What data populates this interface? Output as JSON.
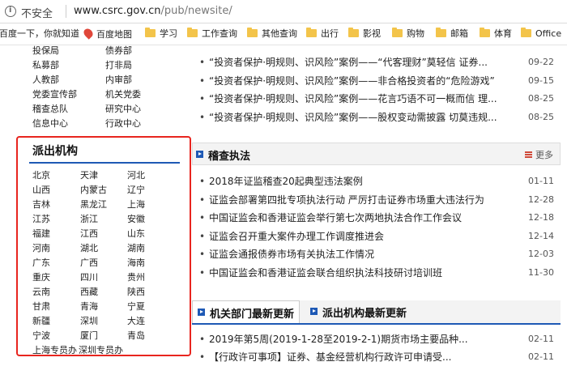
{
  "address_bar": {
    "security_label": "不安全",
    "url_host": "www.csrc.gov.cn",
    "url_path": "/pub/newsite/"
  },
  "bookmarks": [
    "百度一下，你就知道",
    "百度地图",
    "学习",
    "工作查询",
    "其他查询",
    "出行",
    "影视",
    "购物",
    "邮箱",
    "体育",
    "Office"
  ],
  "left_menu": [
    [
      "投保局",
      "债券部"
    ],
    [
      "私募部",
      "打非局"
    ],
    [
      "人教部",
      "内审部"
    ],
    [
      "党委宣传部",
      "机关党委"
    ],
    [
      "稽查总队",
      "研究中心"
    ],
    [
      "信息中心",
      "行政中心"
    ]
  ],
  "agencies": {
    "title": "派出机构",
    "rows": [
      [
        "北京",
        "天津",
        "河北"
      ],
      [
        "山西",
        "内蒙古",
        "辽宁"
      ],
      [
        "吉林",
        "黑龙江",
        "上海"
      ],
      [
        "江苏",
        "浙江",
        "安徽"
      ],
      [
        "福建",
        "江西",
        "山东"
      ],
      [
        "河南",
        "湖北",
        "湖南"
      ],
      [
        "广东",
        "广西",
        "海南"
      ],
      [
        "重庆",
        "四川",
        "贵州"
      ],
      [
        "云南",
        "西藏",
        "陕西"
      ],
      [
        "甘肃",
        "青海",
        "宁夏"
      ],
      [
        "新疆",
        "深圳",
        "大连"
      ],
      [
        "宁波",
        "厦门",
        "青岛"
      ],
      [
        "上海专员办",
        "深圳专员办"
      ]
    ]
  },
  "top_news": [
    {
      "title": "“投资者保护·明规则、识风险”案例——“代客理财”莫轻信 证券...",
      "date": "09-22"
    },
    {
      "title": "“投资者保护·明规则、识风险”案例——非合格投资者的“危险游戏”",
      "date": "09-15"
    },
    {
      "title": "“投资者保护·明规则、识风险”案例——花言巧语不可一概而信 理...",
      "date": "08-25"
    },
    {
      "title": "“投资者保护·明规则、识风险”案例——股权变动需披露 切莫违规...",
      "date": "08-25"
    }
  ],
  "inspection": {
    "title": "稽查执法",
    "more": "更多",
    "items": [
      {
        "title": "2018年证监稽查20起典型违法案例",
        "date": "01-11"
      },
      {
        "title": "证监会部署第四批专项执法行动 严厉打击证券市场重大违法行为",
        "date": "12-28"
      },
      {
        "title": "中国证监会和香港证监会举行第七次两地执法合作工作会议",
        "date": "12-18"
      },
      {
        "title": "证监会召开重大案件办理工作调度推进会",
        "date": "12-14"
      },
      {
        "title": "证监会通报债券市场有关执法工作情况",
        "date": "12-03"
      },
      {
        "title": "中国证监会和香港证监会联合组织执法科技研讨培训班",
        "date": "11-30"
      }
    ]
  },
  "tabs": [
    "机关部门最新更新",
    "派出机构最新更新"
  ],
  "updates": [
    {
      "title": "2019年第5周(2019-1-28至2019-2-1)期货市场主要品种...",
      "date": "02-11"
    },
    {
      "title": "【行政许可事项】证券、基金经营机构行政许可申请受...",
      "date": "02-11"
    }
  ]
}
